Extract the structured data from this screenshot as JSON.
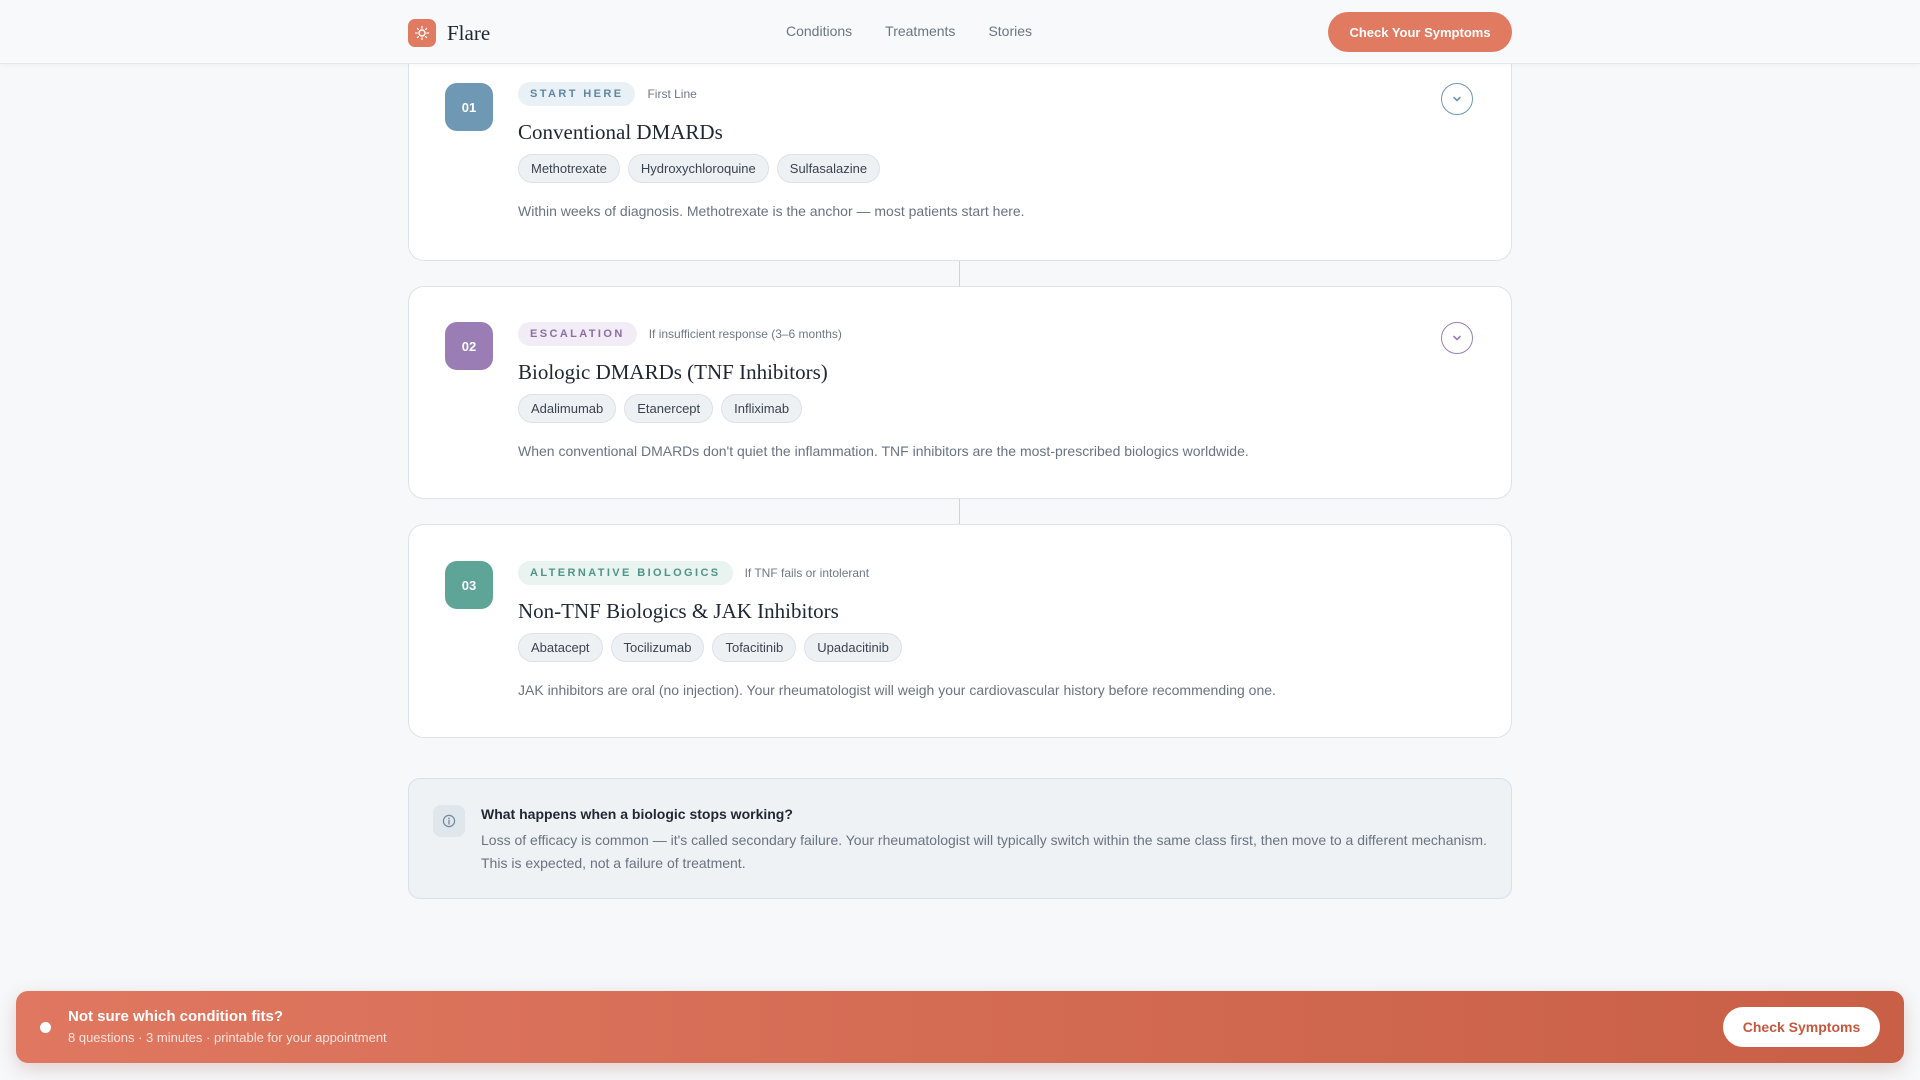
{
  "header": {
    "brand": "Flare",
    "nav": [
      "Conditions",
      "Treatments",
      "Stories"
    ],
    "cta_label": "Check Your Symptoms",
    "accent_color": "#e07a61"
  },
  "steps": [
    {
      "number": "01",
      "stage": "START HERE",
      "note": "First Line",
      "title": "Conventional DMARDs",
      "drugs": [
        "Methotrexate",
        "Hydroxychloroquine",
        "Sulfasalazine"
      ],
      "description": "Within weeks of diagnosis. Methotrexate is the anchor — most patients start here.",
      "color": "#6f98b4",
      "tag_bg": "#eaf1f6",
      "tag_fg": "#5d87a3",
      "expand_icon": "chevron-down-icon"
    },
    {
      "number": "02",
      "stage": "ESCALATION",
      "note": "If insufficient response (3–6 months)",
      "title": "Biologic DMARDs (TNF Inhibitors)",
      "drugs": [
        "Adalimumab",
        "Etanercept",
        "Infliximab"
      ],
      "description": "When conventional DMARDs don't quiet the inflammation. TNF inhibitors are the most-prescribed biologics worldwide.",
      "color": "#9b7db5",
      "tag_bg": "#f1ecf5",
      "tag_fg": "#8b6ea4",
      "expand_icon": "chevron-down-icon"
    },
    {
      "number": "03",
      "stage": "ALTERNATIVE BIOLOGICS",
      "note": "If TNF fails or intolerant",
      "title": "Non-TNF Biologics & JAK Inhibitors",
      "drugs": [
        "Abatacept",
        "Tocilizumab",
        "Tofacitinib",
        "Upadacitinib"
      ],
      "description": "JAK inhibitors are oral (no injection). Your rheumatologist will weigh your cardiovascular history before recommending one.",
      "color": "#5fa597",
      "tag_bg": "#e9f3f0",
      "tag_fg": "#4f9587"
    }
  ],
  "info": {
    "icon": "info-icon",
    "title": "What happens when a biologic stops working?",
    "text": "Loss of efficacy is common — it's called secondary failure. Your rheumatologist will typically switch within the same class first, then move to a different mechanism. This is expected, not a failure of treatment."
  },
  "banner": {
    "title": "Not sure which condition fits?",
    "subtitle": "8 questions · 3 minutes · printable for your appointment",
    "button_label": "Check Symptoms"
  }
}
